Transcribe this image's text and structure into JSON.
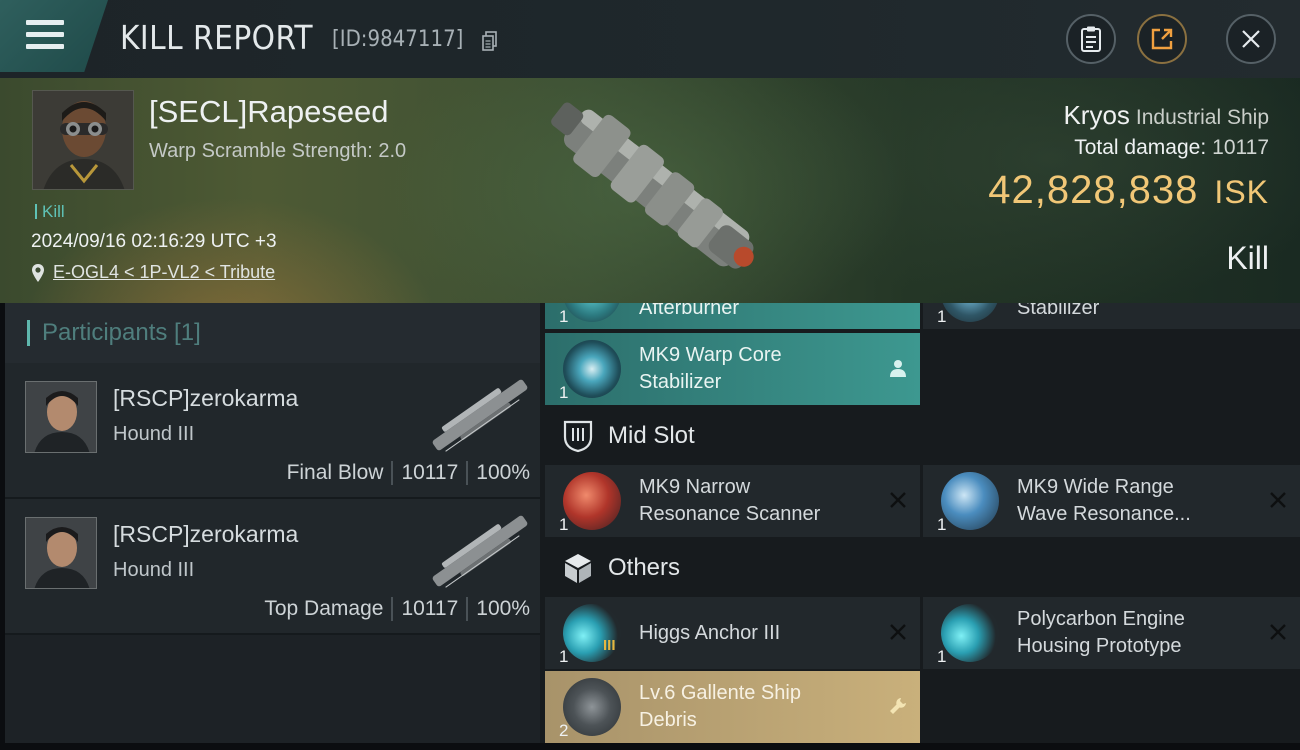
{
  "header": {
    "title": "KILL REPORT",
    "report_id": "[ID:9847117]"
  },
  "victim": {
    "name": "[SECL]Rapeseed",
    "subtitle": "Warp Scramble Strength: 2.0",
    "tag": "Kill",
    "datetime": "2024/09/16 02:16:29 UTC +3",
    "location": "E-OGL4 < 1P-VL2 < Tribute",
    "ship": "Kryos",
    "ship_class": "Industrial Ship",
    "total_damage_label": "Total damage:",
    "total_damage": "10117",
    "isk_value": "42,828,838",
    "isk_unit": "ISK",
    "outcome": "Kill"
  },
  "participants": {
    "label": "Participants [1]",
    "rows": [
      {
        "name": "[RSCP]zerokarma",
        "ship": "Hound III",
        "role": "Final Blow",
        "damage": "10117",
        "percent": "100%"
      },
      {
        "name": "[RSCP]zerokarma",
        "ship": "Hound III",
        "role": "Top Damage",
        "damage": "10117",
        "percent": "100%"
      }
    ]
  },
  "modules": {
    "top_partial": [
      {
        "name": "Afterburner",
        "qty": "1"
      },
      {
        "name": "Stabilizer",
        "qty": "1"
      }
    ],
    "warp_core": {
      "name_line1": "MK9 Warp Core",
      "name_line2": "Stabilizer",
      "qty": "1"
    },
    "mid_slot_label": "Mid Slot",
    "mid": [
      {
        "name_line1": "MK9 Narrow",
        "name_line2": "Resonance Scanner",
        "qty": "1"
      },
      {
        "name_line1": "MK9 Wide Range",
        "name_line2": "Wave Resonance...",
        "qty": "1"
      }
    ],
    "others_label": "Others",
    "others": [
      {
        "name_line1": "Higgs Anchor III",
        "name_line2": "",
        "qty": "1",
        "badge": "III"
      },
      {
        "name_line1": "Polycarbon Engine",
        "name_line2": "Housing Prototype",
        "qty": "1"
      }
    ],
    "debris": {
      "name_line1": "Lv.6 Gallente Ship",
      "name_line2": "Debris",
      "qty": "2"
    }
  },
  "colors": {
    "accent_teal": "#3d9890",
    "isk_gold": "#f1c777",
    "debris_gold": "#c9b07b"
  }
}
